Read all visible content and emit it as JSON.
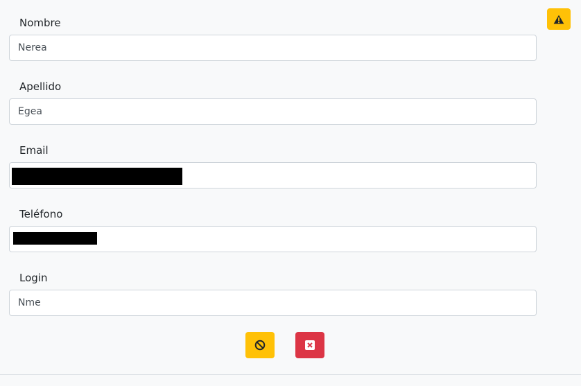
{
  "warning_button": {
    "icon": "warning-icon",
    "color": "#ffc107"
  },
  "fields": [
    {
      "label": "Nombre",
      "value": "Nerea",
      "redacted": false
    },
    {
      "label": "Apellido",
      "value": "Egea",
      "redacted": false
    },
    {
      "label": "Email",
      "value": "",
      "redacted": true
    },
    {
      "label": "Teléfono",
      "value": "",
      "redacted": true
    },
    {
      "label": "Login",
      "value": "Nme",
      "redacted": false
    }
  ],
  "actions": {
    "cancel": {
      "icon": "ban-icon",
      "color": "#ffc107"
    },
    "delete": {
      "icon": "close-square-icon",
      "color": "#dc3545"
    }
  }
}
